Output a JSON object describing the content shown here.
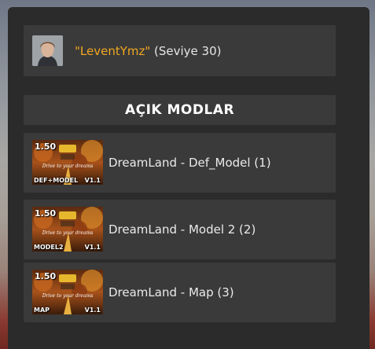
{
  "profile": {
    "username": "\"LeventYmz\"",
    "level_text": " (Seviye 30)"
  },
  "section": {
    "title": "AÇIK MODLAR"
  },
  "mods": [
    {
      "name": "DreamLand - Def_Model (1)",
      "thumb_version": "1.50",
      "thumb_tag": "DEF+MODEL",
      "thumb_mod_version": "V1.1"
    },
    {
      "name": "DreamLand - Model 2 (2)",
      "thumb_version": "1.50",
      "thumb_tag": "MODEL2",
      "thumb_mod_version": "V1.1"
    },
    {
      "name": "DreamLand - Map (3)",
      "thumb_version": "1.50",
      "thumb_tag": "MAP",
      "thumb_mod_version": "V1.1"
    }
  ],
  "colors": {
    "panel_bg": "#2b2b2b",
    "card_bg": "#3a3a3a",
    "username": "#f0a720",
    "text": "#e6e6e6"
  },
  "icons": {
    "avatar": "user-avatar",
    "thumbnail": "mod-thumbnail"
  }
}
